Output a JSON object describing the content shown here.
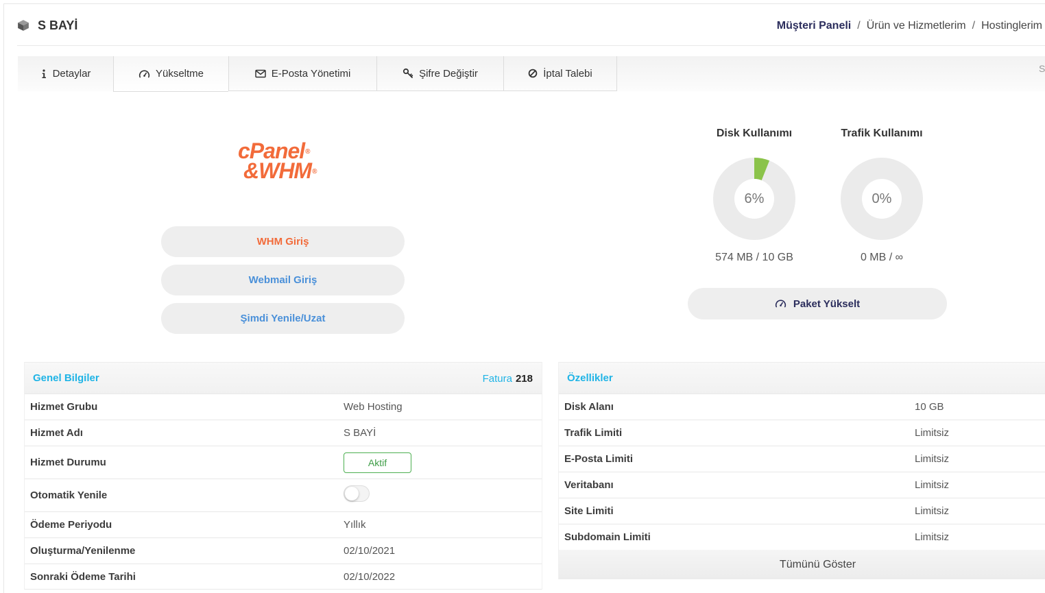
{
  "header": {
    "title": "S BAYİ",
    "icon": "box-icon"
  },
  "breadcrumb": {
    "separator": "/",
    "items": [
      "Müşteri Paneli",
      "Ürün ve Hizmetlerim",
      "Hostinglerim"
    ]
  },
  "tabs": [
    {
      "label": "Detaylar",
      "icon": "info-icon",
      "active": true
    },
    {
      "label": "Yükseltme",
      "icon": "gauge-icon",
      "active": false
    },
    {
      "label": "E-Posta Yönetimi",
      "icon": "envelope-icon",
      "active": false
    },
    {
      "label": "Şifre Değiştir",
      "icon": "key-icon",
      "active": false
    },
    {
      "label": "İptal Talebi",
      "icon": "ban-icon",
      "active": false
    }
  ],
  "tabs_overflow_text": "S",
  "logo": {
    "line1": "cPanel",
    "line2": "&WHM",
    "registered": "®"
  },
  "actions": [
    {
      "label": "WHM Giriş",
      "color": "#f26b3a"
    },
    {
      "label": "Webmail Giriş",
      "color": "#4a90d9"
    },
    {
      "label": "Şimdi Yenile/Uzat",
      "color": "#4a90d9"
    }
  ],
  "usage": {
    "disk": {
      "title": "Disk Kullanımı",
      "percent": 6,
      "percent_label": "6%",
      "amount": "574 MB / 10 GB"
    },
    "traffic": {
      "title": "Trafik Kullanımı",
      "percent": 0,
      "percent_label": "0%",
      "amount": "0 MB / ∞"
    }
  },
  "upgrade_button": {
    "label": "Paket Yükselt",
    "icon": "gauge-icon"
  },
  "general_info": {
    "title": "Genel Bilgiler",
    "invoice_label": "Fatura",
    "invoice_number": "218",
    "rows": [
      {
        "label": "Hizmet Grubu",
        "value": "Web Hosting"
      },
      {
        "label": "Hizmet Adı",
        "value": "S BAYİ"
      },
      {
        "label": "Hizmet Durumu",
        "value": "Aktif"
      },
      {
        "label": "Otomatik Yenile",
        "toggle_on": false
      },
      {
        "label": "Ödeme Periyodu",
        "value": "Yıllık"
      },
      {
        "label": "Oluşturma/Yenilenme",
        "value": "02/10/2021"
      },
      {
        "label": "Sonraki Ödeme Tarihi",
        "value": "02/10/2022"
      }
    ]
  },
  "features": {
    "title": "Özellikler",
    "rows": [
      {
        "label": "Disk Alanı",
        "value": "10 GB"
      },
      {
        "label": "Trafik Limiti",
        "value": "Limitsiz"
      },
      {
        "label": "E-Posta Limiti",
        "value": "Limitsiz"
      },
      {
        "label": "Veritabanı",
        "value": "Limitsiz"
      },
      {
        "label": "Site Limiti",
        "value": "Limitsiz"
      },
      {
        "label": "Subdomain Limiti",
        "value": "Limitsiz"
      }
    ],
    "show_all_label": "Tümünü Göster"
  },
  "colors": {
    "accent": "#1fb4e6",
    "navy": "#2b2d5c",
    "donut_fill": "#8bc34a",
    "donut_track": "#ebebeb",
    "status_green": "#4caf50"
  }
}
